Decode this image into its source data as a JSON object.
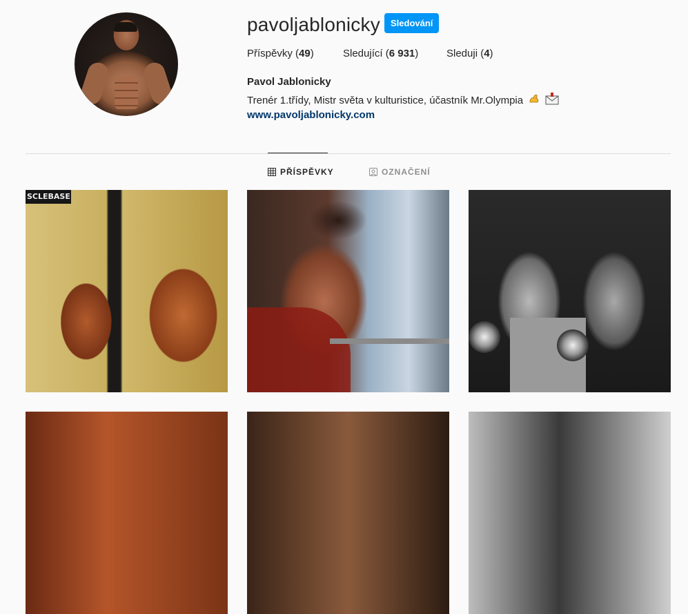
{
  "profile": {
    "username": "pavoljablonicky",
    "follow_label": "Sledování",
    "full_name": "Pavol Jablonicky",
    "bio": "Trenér 1.třídy, Mistr světa v kulturistice, účastník Mr.Olympia",
    "website": "www.pavoljablonicky.com"
  },
  "stats": {
    "posts_label": "Příspěvky",
    "posts_count": "49",
    "followers_label": "Sledující",
    "followers_count": "6 931",
    "following_label": "Sleduji",
    "following_count": "4"
  },
  "tabs": [
    {
      "label": "PŘÍSPĚVKY",
      "icon": "grid-icon",
      "active": true
    },
    {
      "label": "OZNAČENÍ",
      "icon": "tagged-icon",
      "active": false
    }
  ],
  "bio_emojis": [
    "flexed-biceps-emoji",
    "incoming-envelope-emoji"
  ],
  "colors": {
    "accent": "#0095f6",
    "link": "#00376b",
    "text": "#262626",
    "muted": "#8e8e8e",
    "background": "#fafafa"
  },
  "posts": [
    {
      "sign_text": "SCLEBASE"
    },
    {},
    {},
    {},
    {},
    {}
  ]
}
